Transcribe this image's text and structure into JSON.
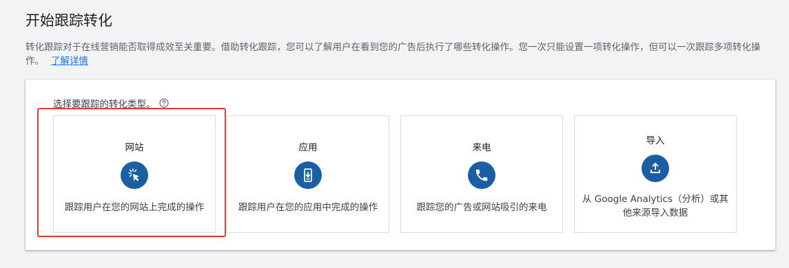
{
  "page": {
    "title": "开始跟踪转化",
    "description": "转化跟踪对于在线营销能否取得成效至关重要。借助转化跟踪，您可以了解用户在看到您的广告后执行了哪些转化操作。您一次只能设置一项转化操作，但可以一次跟踪多项转化操作。",
    "learn_more": "了解详情"
  },
  "selector": {
    "prompt": "选择要跟踪的转化类型。",
    "options": [
      {
        "title": "网站",
        "icon": "click-cursor-icon",
        "description": "跟踪用户在您的网站上完成的操作",
        "highlighted": true
      },
      {
        "title": "应用",
        "icon": "phone-download-icon",
        "description": "跟踪用户在您的应用中完成的操作",
        "highlighted": false
      },
      {
        "title": "来电",
        "icon": "phone-call-icon",
        "description": "跟踪您的广告或网站吸引的来电",
        "highlighted": false
      },
      {
        "title": "导入",
        "icon": "upload-icon",
        "description": "从 Google Analytics（分析）或其他来源导入数据",
        "highlighted": false
      }
    ]
  },
  "colors": {
    "accent": "#1a73e8",
    "icon_bg": "#1a5ea3",
    "highlight": "#e53935"
  }
}
